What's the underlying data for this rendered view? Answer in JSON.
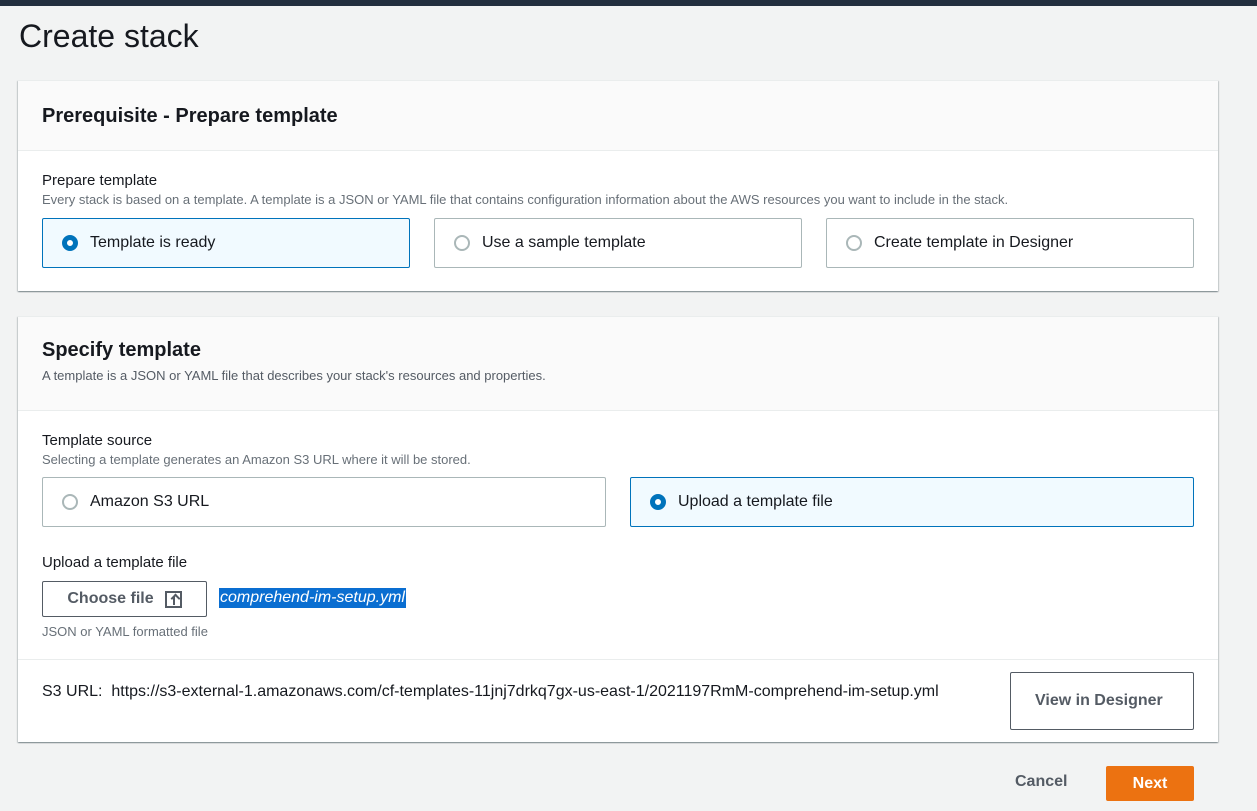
{
  "page": {
    "title": "Create stack"
  },
  "prerequisite": {
    "title": "Prerequisite - Prepare template",
    "field_label": "Prepare template",
    "field_desc": "Every stack is based on a template. A template is a JSON or YAML file that contains configuration information about the AWS resources you want to include in the stack.",
    "options": [
      {
        "label": "Template is ready",
        "selected": true
      },
      {
        "label": "Use a sample template",
        "selected": false
      },
      {
        "label": "Create template in Designer",
        "selected": false
      }
    ]
  },
  "specify": {
    "title": "Specify template",
    "desc": "A template is a JSON or YAML file that describes your stack's resources and properties.",
    "source_label": "Template source",
    "source_desc": "Selecting a template generates an Amazon S3 URL where it will be stored.",
    "sources": [
      {
        "label": "Amazon S3 URL",
        "selected": false
      },
      {
        "label": "Upload a template file",
        "selected": true
      }
    ],
    "upload_label": "Upload a template file",
    "choose_file_label": "Choose file",
    "file_name": "comprehend-im-setup.yml",
    "upload_hint": "JSON or YAML formatted file",
    "s3_url_label": "S3 URL:",
    "s3_url_value": "https://s3-external-1.amazonaws.com/cf-templates-11jnj7drkq7gx-us-east-1/2021197RmM-comprehend-im-setup.yml",
    "view_designer_label": "View in Designer"
  },
  "footer": {
    "cancel_label": "Cancel",
    "next_label": "Next"
  },
  "colors": {
    "accent": "#0073bb",
    "primary_button": "#ec7211",
    "selection_highlight": "#0a6ed1"
  },
  "icons": {
    "upload": "upload-icon"
  }
}
